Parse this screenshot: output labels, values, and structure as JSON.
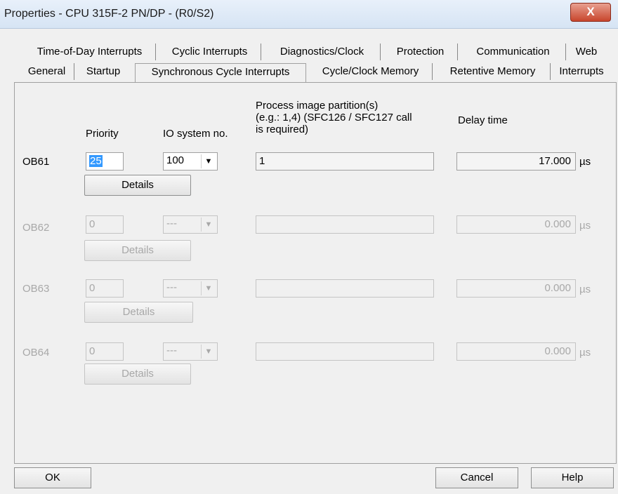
{
  "window": {
    "title": "Properties - CPU 315F-2 PN/DP - (R0/S2)",
    "close_label": "X"
  },
  "tabs": {
    "row1": [
      "Time-of-Day Interrupts",
      "Cyclic Interrupts",
      "Diagnostics/Clock",
      "Protection",
      "Communication",
      "Web"
    ],
    "row2": [
      "General",
      "Startup",
      "Synchronous Cycle Interrupts",
      "Cycle/Clock Memory",
      "Retentive Memory",
      "Interrupts"
    ],
    "active": "Synchronous Cycle Interrupts"
  },
  "headers": {
    "priority": "Priority",
    "io_system": "IO system no.",
    "process_image": "Process image partition(s)\n(e.g.: 1,4) (SFC126 / SFC127 call\nis required)",
    "delay_time": "Delay time"
  },
  "rows": [
    {
      "ob": "OB61",
      "priority": "25",
      "io_system": "100",
      "partition": "1",
      "delay": "17.000",
      "unit": "µs",
      "details": "Details",
      "enabled": true
    },
    {
      "ob": "OB62",
      "priority": "0",
      "io_system": "---",
      "partition": "",
      "delay": "0.000",
      "unit": "µs",
      "details": "Details",
      "enabled": false
    },
    {
      "ob": "OB63",
      "priority": "0",
      "io_system": "---",
      "partition": "",
      "delay": "0.000",
      "unit": "µs",
      "details": "Details",
      "enabled": false
    },
    {
      "ob": "OB64",
      "priority": "0",
      "io_system": "---",
      "partition": "",
      "delay": "0.000",
      "unit": "µs",
      "details": "Details",
      "enabled": false
    }
  ],
  "footer": {
    "ok": "OK",
    "cancel": "Cancel",
    "help": "Help"
  }
}
